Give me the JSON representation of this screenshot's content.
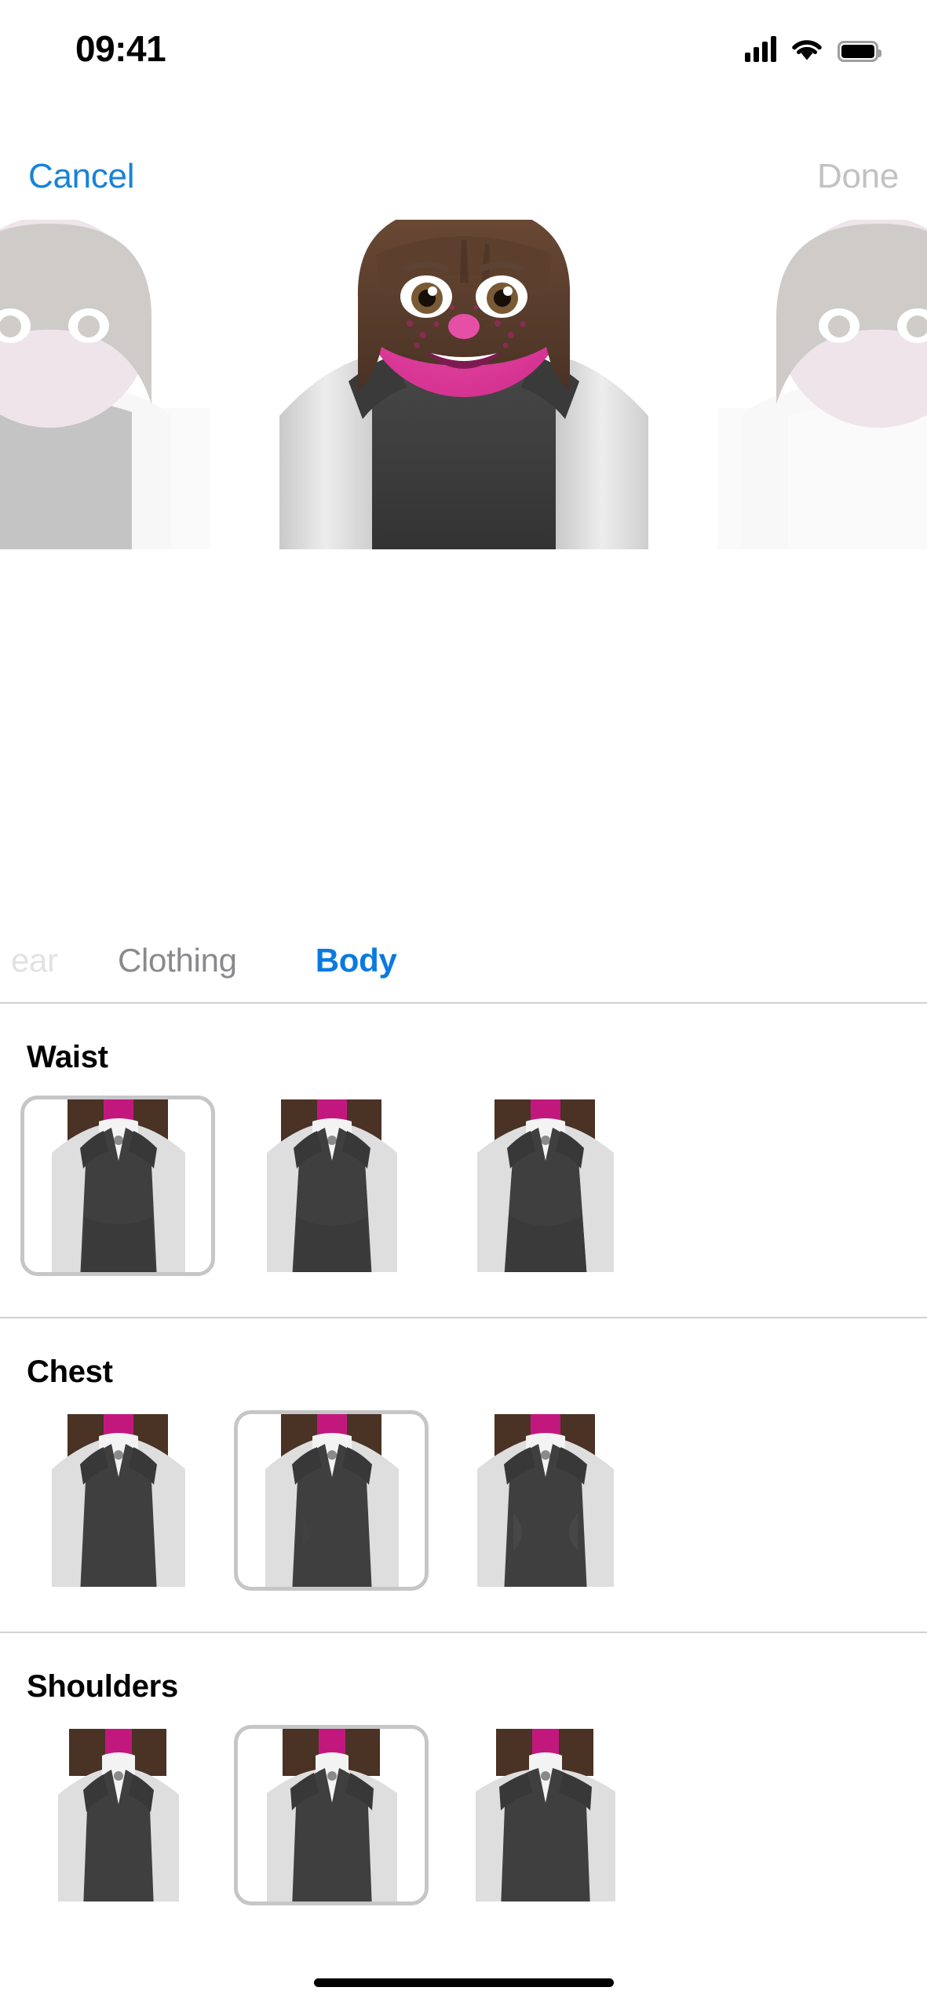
{
  "status_bar": {
    "time": "09:41",
    "signal_icon": "cellular-signal-icon",
    "wifi_icon": "wifi-icon",
    "battery_icon": "battery-full-icon",
    "battery_level_percent": 100
  },
  "nav_bar": {
    "cancel_label": "Cancel",
    "done_label": "Done",
    "done_enabled": false,
    "cancel_color": "#1883d7",
    "done_color": "#c2c2c4"
  },
  "avatar_preview": {
    "name": "memoji-avatar-preview",
    "skin_color": "#e0399c",
    "hair_color": "#5a3a2a",
    "shirt_color": "#f2f2f2",
    "vest_color": "#3d3d3d",
    "arm_color": "#d8d8d8",
    "eye_color": "#7a5a34",
    "neighbors_visible": 2
  },
  "tab_bar": {
    "active_color": "#0a7ae0",
    "inactive_color": "#8a8a8e",
    "tabs": [
      {
        "label": "ear",
        "state": "clipped"
      },
      {
        "label": "Clothing",
        "state": "inactive"
      },
      {
        "label": "Body",
        "state": "active"
      }
    ]
  },
  "sections": [
    {
      "title": "Waist",
      "selected_index": 0,
      "options": [
        {
          "label": "Waist option 1"
        },
        {
          "label": "Waist option 2"
        },
        {
          "label": "Waist option 3"
        }
      ]
    },
    {
      "title": "Chest",
      "selected_index": 1,
      "options": [
        {
          "label": "Chest option 1"
        },
        {
          "label": "Chest option 2"
        },
        {
          "label": "Chest option 3"
        }
      ]
    },
    {
      "title": "Shoulders",
      "selected_index": 1,
      "options": [
        {
          "label": "Shoulders option 1"
        },
        {
          "label": "Shoulders option 2"
        },
        {
          "label": "Shoulders option 3"
        }
      ]
    }
  ],
  "selection_border_color": "#c6c6c8",
  "home_indicator": {
    "name": "home-indicator"
  }
}
